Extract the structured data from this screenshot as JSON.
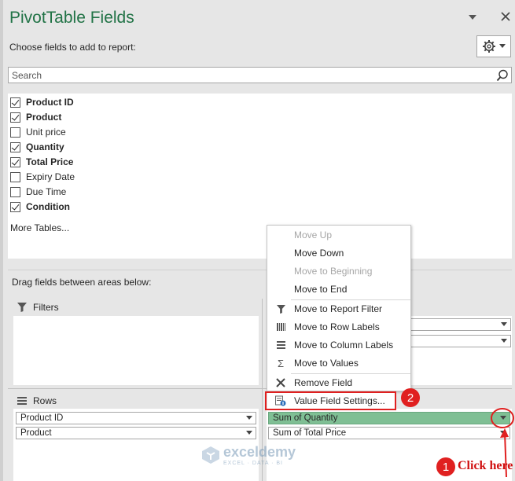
{
  "panel": {
    "title": "PivotTable Fields",
    "subtitle": "Choose fields to add to report:",
    "search_placeholder": "Search"
  },
  "fields": [
    {
      "label": "Product ID",
      "checked": true
    },
    {
      "label": "Product",
      "checked": true
    },
    {
      "label": "Unit price",
      "checked": false
    },
    {
      "label": "Quantity",
      "checked": true
    },
    {
      "label": "Total Price",
      "checked": true
    },
    {
      "label": "Expiry Date",
      "checked": false
    },
    {
      "label": "Due Time",
      "checked": false
    },
    {
      "label": "Condition",
      "checked": true
    }
  ],
  "more_tables": "More Tables...",
  "drag_label": "Drag fields between areas below:",
  "areas": {
    "filters": "Filters",
    "rows": "Rows"
  },
  "rows_fields": [
    "Product ID",
    "Product"
  ],
  "values_fields": [
    "Sum of Quantity",
    "Sum of Total Price"
  ],
  "context_menu": {
    "items": [
      {
        "label": "Move Up",
        "icon": "",
        "disabled": true
      },
      {
        "label": "Move Down",
        "icon": "",
        "disabled": false
      },
      {
        "label": "Move to Beginning",
        "icon": "",
        "disabled": true
      },
      {
        "label": "Move to End",
        "icon": "",
        "disabled": false
      },
      {
        "label": "Move to Report Filter",
        "icon": "filter-icon",
        "disabled": false
      },
      {
        "label": "Move to Row Labels",
        "icon": "row-labels-icon",
        "disabled": false
      },
      {
        "label": "Move to Column Labels",
        "icon": "column-labels-icon",
        "disabled": false
      },
      {
        "label": "Move to Values",
        "icon": "sigma-icon",
        "disabled": false
      },
      {
        "label": "Remove Field",
        "icon": "remove-x-icon",
        "disabled": false
      },
      {
        "label": "Value Field Settings...",
        "icon": "field-settings-icon",
        "disabled": false
      }
    ]
  },
  "annotations": {
    "step1": "1",
    "step2": "2",
    "click_here": "Click here"
  },
  "watermark": {
    "name": "exceldemy",
    "tagline": "EXCEL · DATA · BI"
  },
  "colors": {
    "title_green": "#217346",
    "active_pill": "#7fbf94",
    "annotation_red": "#e02020"
  }
}
